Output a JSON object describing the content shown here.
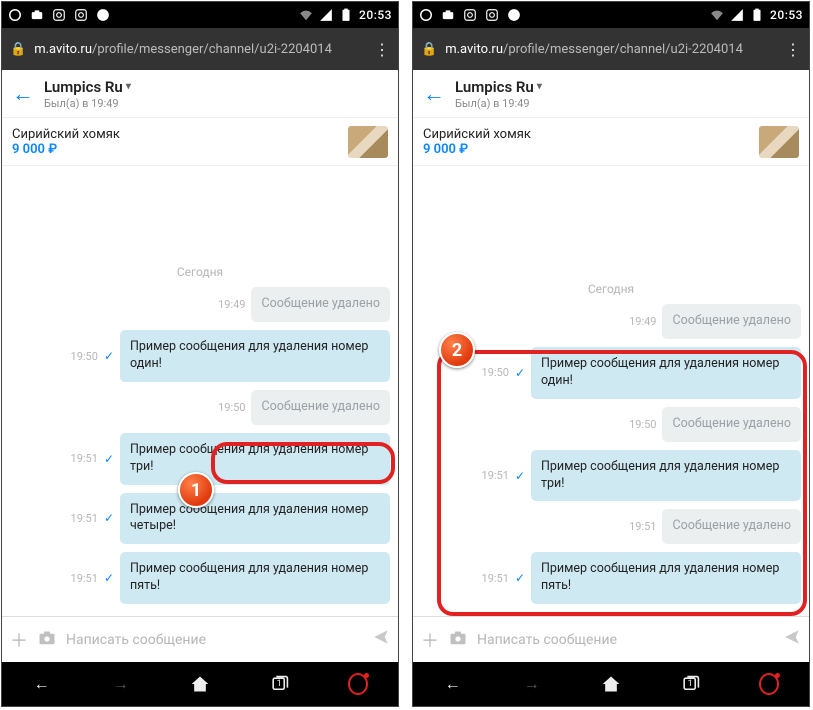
{
  "status": {
    "time": "20:53",
    "tray_icons": [
      "opera-icon",
      "camera-icon",
      "instagram-icon",
      "instagram-icon",
      "shazam-icon"
    ],
    "right_icons": [
      "wifi-icon",
      "signal-icon",
      "battery-icon"
    ]
  },
  "urlbar": {
    "host": "m.avito.ru",
    "path": "/profile/messenger/channel/u2i-2204014"
  },
  "chat": {
    "title": "Lumpics Ru",
    "last_seen": "Был(а) в 19:49",
    "listing_name": "Сирийский хомяк",
    "listing_price": "9 000 ₽",
    "day_separator": "Сегодня"
  },
  "composer": {
    "placeholder": "Написать сообщение"
  },
  "callouts": {
    "one": "1",
    "two": "2"
  },
  "left_msgs": [
    {
      "time": "19:49",
      "text": "Сообщение удалено",
      "deleted": true,
      "showStatus": false
    },
    {
      "time": "19:50",
      "text": "Пример сообщения для удаления номер один!",
      "deleted": false,
      "showStatus": true
    },
    {
      "time": "19:50",
      "text": "Сообщение удалено",
      "deleted": true,
      "showStatus": false
    },
    {
      "time": "19:51",
      "text": "Пример сообщения для удаления номер три!",
      "deleted": false,
      "showStatus": true
    },
    {
      "time": "19:51",
      "text": "Пример сообщения для удаления номер четыре!",
      "deleted": false,
      "showStatus": true
    },
    {
      "time": "19:51",
      "text": "Пример сообщения для удаления номер пять!",
      "deleted": false,
      "showStatus": true
    }
  ],
  "right_msgs": [
    {
      "time": "19:49",
      "text": "Сообщение удалено",
      "deleted": true,
      "showStatus": false
    },
    {
      "time": "19:50",
      "text": "Пример сообщения для удаления номер один!",
      "deleted": false,
      "showStatus": true
    },
    {
      "time": "19:50",
      "text": "Сообщение удалено",
      "deleted": true,
      "showStatus": false
    },
    {
      "time": "19:51",
      "text": "Пример сообщения для удаления номер три!",
      "deleted": false,
      "showStatus": true
    },
    {
      "time": "19:51",
      "text": "Сообщение удалено",
      "deleted": true,
      "showStatus": false
    },
    {
      "time": "19:51",
      "text": "Пример сообщения для удаления номер пять!",
      "deleted": false,
      "showStatus": true
    }
  ]
}
